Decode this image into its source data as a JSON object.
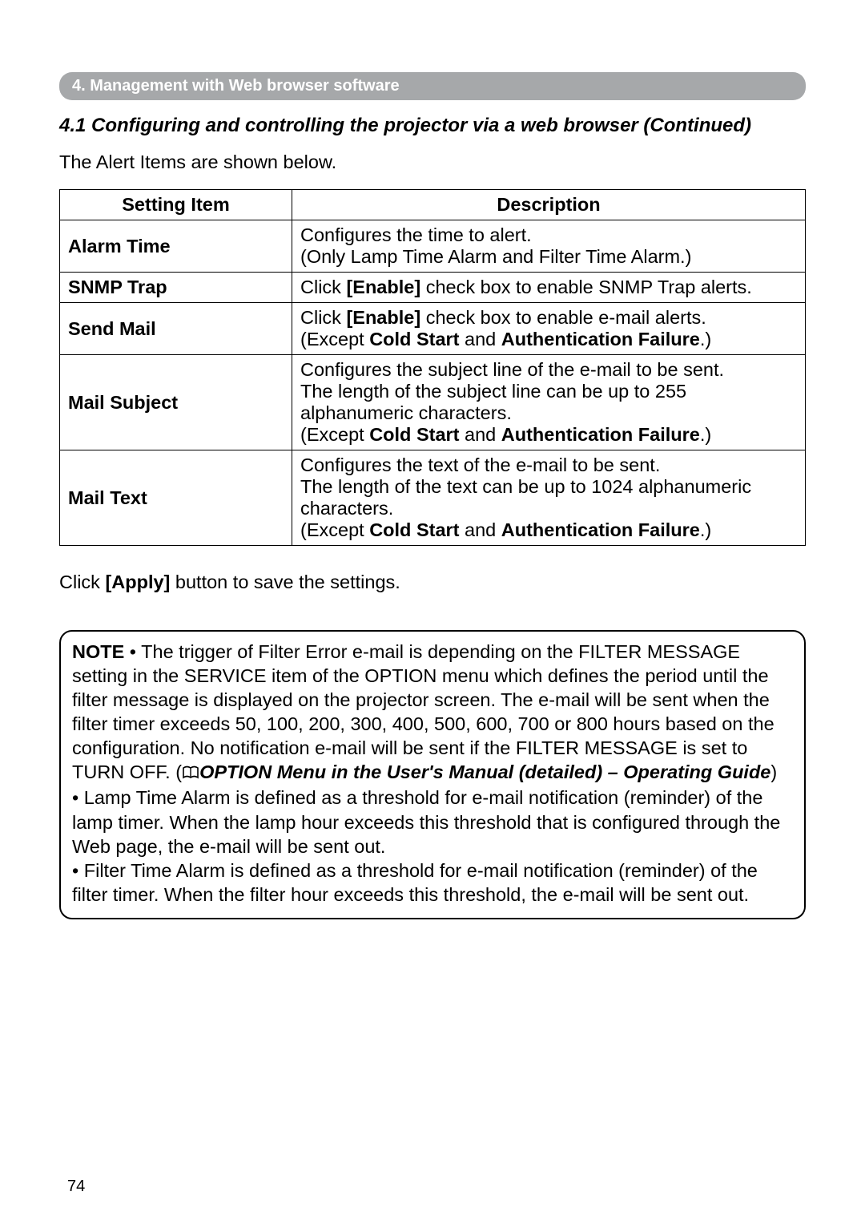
{
  "banner": "4. Management with Web browser software",
  "heading": "4.1 Configuring and controlling the projector via a web browser (Continued)",
  "intro": "The Alert Items are shown below.",
  "table": {
    "headers": {
      "col1": "Setting Item",
      "col2": "Description"
    },
    "rows": [
      {
        "name": "Alarm Time",
        "desc": {
          "pre": "Configures the time to alert.\n(Only Lamp Time Alarm and Filter Time Alarm.)"
        }
      },
      {
        "name": "SNMP Trap",
        "desc": {
          "t1": "Click ",
          "b1": "[Enable]",
          "t2": " check box to enable SNMP Trap alerts."
        }
      },
      {
        "name": "Send Mail",
        "desc": {
          "t1": "Click ",
          "b1": "[Enable]",
          "t2": " check box to enable e-mail alerts.\n(Except ",
          "b2": "Cold Start",
          "t3": " and ",
          "b3": "Authentication Failure",
          "t4": ".)"
        }
      },
      {
        "name": "Mail Subject",
        "desc": {
          "t1": "Configures the subject line of the e-mail to be sent.\nThe length of the subject line can be up to 255 alphanumeric characters.\n(Except ",
          "b1": "Cold Start",
          "t2": " and ",
          "b2": "Authentication Failure",
          "t3": ".)"
        }
      },
      {
        "name": "Mail Text",
        "desc": {
          "t1": "Configures the text of the e-mail to be sent.\nThe length of the text can be up to 1024 alphanumeric characters.\n(Except ",
          "b1": "Cold Start",
          "t2": " and ",
          "b2": "Authentication Failure",
          "t3": ".)"
        }
      }
    ]
  },
  "apply": {
    "t1": "Click ",
    "b1": "[Apply]",
    "t2": " button to save the settings."
  },
  "note": {
    "label": "NOTE",
    "p1a": "  •  The trigger of Filter Error e-mail is depending on the FILTER MESSAGE setting in the SERVICE item of the OPTION menu which defines the period until the filter message is displayed on the projector screen. The e-mail will be sent when the filter timer exceeds 50, 100, 200, 300, 400, 500, 600, 700 or 800 hours based on the configuration. No notification e-mail will be sent if the FILTER MESSAGE is set to TURN OFF. (",
    "p1b": "OPTION Menu in the User's Manual (detailed) – Operating Guide",
    "p1c": ")",
    "p2": "• Lamp Time Alarm is defined as a threshold for e-mail notification (reminder) of the lamp timer. When the lamp hour exceeds this threshold that is configured through the Web page, the e-mail will be sent out.",
    "p3": "• Filter Time Alarm is defined as a threshold for e-mail notification (reminder) of the filter timer. When the filter hour exceeds this threshold, the e-mail will be sent out."
  },
  "pageNumber": "74",
  "chart_data": {
    "type": "table",
    "title": "Alert Items settings",
    "columns": [
      "Setting Item",
      "Description"
    ],
    "rows": [
      [
        "Alarm Time",
        "Configures the time to alert. (Only Lamp Time Alarm and Filter Time Alarm.)"
      ],
      [
        "SNMP Trap",
        "Click [Enable] check box to enable SNMP Trap alerts."
      ],
      [
        "Send Mail",
        "Click [Enable] check box to enable e-mail alerts. (Except Cold Start and Authentication Failure.)"
      ],
      [
        "Mail Subject",
        "Configures the subject line of the e-mail to be sent. The length of the subject line can be up to 255 alphanumeric characters. (Except Cold Start and Authentication Failure.)"
      ],
      [
        "Mail Text",
        "Configures the text of the e-mail to be sent. The length of the text can be up to 1024 alphanumeric characters. (Except Cold Start and Authentication Failure.)"
      ]
    ]
  }
}
